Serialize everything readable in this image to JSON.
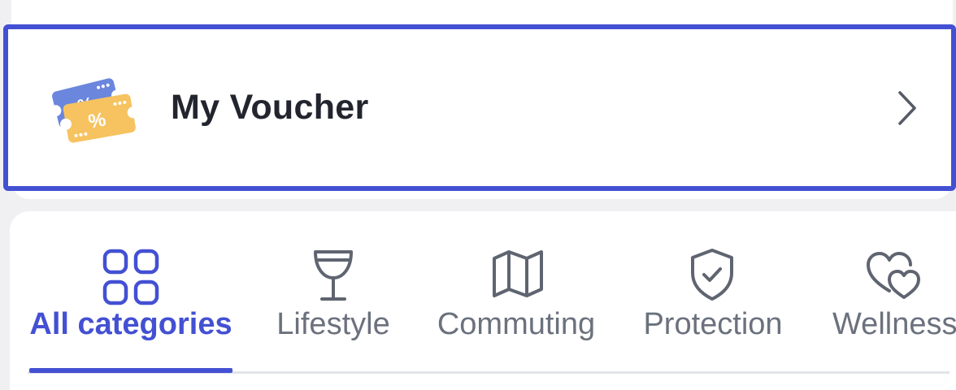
{
  "voucher": {
    "title": "My Voucher",
    "icon": "voucher-ticket-icon",
    "chevron": "chevron-right-icon"
  },
  "categories": {
    "active_index": 0,
    "items": [
      {
        "label": "All categories",
        "icon": "grid-icon"
      },
      {
        "label": "Lifestyle",
        "icon": "wine-glass-icon"
      },
      {
        "label": "Commuting",
        "icon": "map-icon"
      },
      {
        "label": "Protection",
        "icon": "shield-check-icon"
      },
      {
        "label": "Wellness",
        "icon": "hearts-icon"
      }
    ]
  },
  "colors": {
    "accent": "#4350d3",
    "text": "#22252e",
    "muted": "#6b717d",
    "background": "#f0f0f2"
  }
}
